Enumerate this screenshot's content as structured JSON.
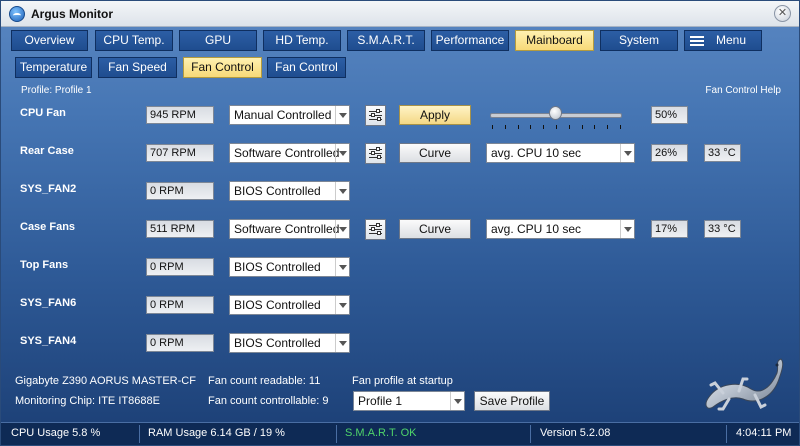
{
  "window": {
    "title": "Argus Monitor"
  },
  "main_tabs": [
    {
      "label": "Overview"
    },
    {
      "label": "CPU Temp."
    },
    {
      "label": "GPU"
    },
    {
      "label": "HD Temp."
    },
    {
      "label": "S.M.A.R.T."
    },
    {
      "label": "Performance"
    },
    {
      "label": "Mainboard",
      "active": true
    },
    {
      "label": "System"
    },
    {
      "label": "Menu"
    }
  ],
  "sub_tabs": [
    {
      "label": "Temperature"
    },
    {
      "label": "Fan Speed"
    },
    {
      "label": "Fan Control",
      "active": true
    },
    {
      "label": "Fan Control"
    }
  ],
  "profile": {
    "label": "Profile: Profile 1",
    "help": "Fan Control Help"
  },
  "fans": [
    {
      "name": "CPU Fan",
      "rpm": "945 RPM",
      "mode": "Manual Controlled",
      "action": "Apply",
      "level_percent": 50,
      "percent": "50%"
    },
    {
      "name": "Rear Case",
      "rpm": "707 RPM",
      "mode": "Software Controlled",
      "action": "Curve",
      "source": "avg. CPU 10 sec",
      "percent": "26%",
      "temp": "33 °C"
    },
    {
      "name": "SYS_FAN2",
      "rpm": "0 RPM",
      "mode": "BIOS Controlled"
    },
    {
      "name": "Case Fans",
      "rpm": "511 RPM",
      "mode": "Software Controlled",
      "action": "Curve",
      "source": "avg. CPU 10 sec",
      "percent": "17%",
      "temp": "33 °C"
    },
    {
      "name": "Top Fans",
      "rpm": "0 RPM",
      "mode": "BIOS Controlled"
    },
    {
      "name": "SYS_FAN6",
      "rpm": "0 RPM",
      "mode": "BIOS Controlled"
    },
    {
      "name": "SYS_FAN4",
      "rpm": "0 RPM",
      "mode": "BIOS Controlled"
    }
  ],
  "footer": {
    "board": "Gigabyte Z390 AORUS MASTER-CF",
    "chip": "Monitoring Chip: ITE IT8688E",
    "readable": "Fan count readable: 11",
    "controllable": "Fan count controllable: 9",
    "startup_label": "Fan profile at startup",
    "startup_profile": "Profile 1",
    "save_label": "Save Profile"
  },
  "status": {
    "cpu": "CPU Usage 5.8 %",
    "ram": "RAM Usage 6.14 GB / 19 %",
    "smart": "S.M.A.R.T. OK",
    "version": "Version 5.2.08",
    "time": "4:04:11 PM"
  },
  "colors": {
    "active_tab": "#f7d978",
    "smart_ok": "#4fd46a",
    "background_top": "#5a87c2",
    "background_bottom": "#1b3e74"
  },
  "icons": {
    "app": "argus-logo-icon",
    "close": "close-icon",
    "menu": "hamburger-icon",
    "tune": "slider-settings-icon",
    "mascot": "gecko-logo"
  }
}
